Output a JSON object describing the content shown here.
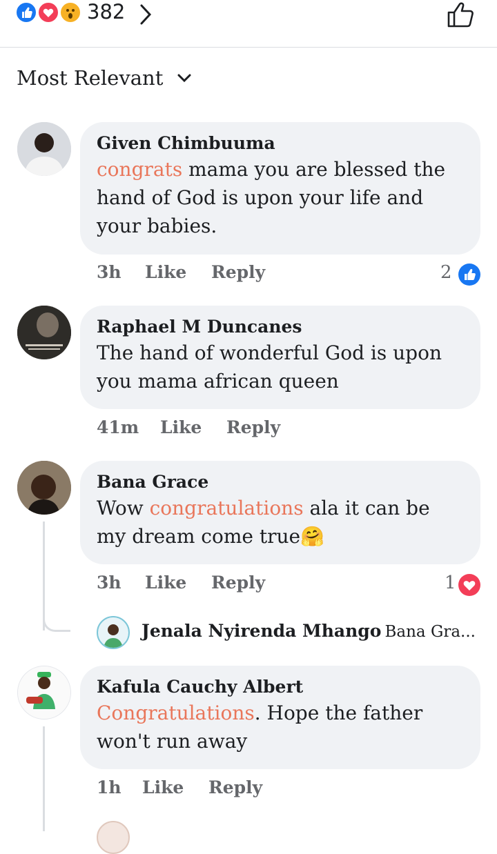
{
  "reactions": {
    "count": "382",
    "types": [
      "like-icon",
      "love-icon",
      "wow-icon"
    ],
    "colors": {
      "like": "#1877f2",
      "love": "#f33e58",
      "wow": "#f7b125"
    }
  },
  "sort": {
    "label": "Most Relevant"
  },
  "comments": [
    {
      "name": "Given Chimbuuma",
      "highlight": "congrats",
      "text": " mama you are blessed the hand of God is upon your life and your babies.",
      "time": "3h",
      "like": "Like",
      "reply": "Reply",
      "reaction_count": "2",
      "reaction": "like"
    },
    {
      "name": "Raphael M Duncanes",
      "highlight": "",
      "text": "The hand of wonderful God is upon you mama african queen",
      "time": "41m",
      "like": "Like",
      "reply": "Reply"
    },
    {
      "name": "Bana Grace",
      "pre": "Wow ",
      "highlight": "congratulations",
      "text": " ala it can be my dream come true🤗",
      "time": "3h",
      "like": "Like",
      "reply": "Reply",
      "reaction_count": "1",
      "reaction": "love",
      "reply_preview": {
        "name": "Jenala Nyirenda Mhango",
        "snippet": "Bana Gra..."
      }
    },
    {
      "name": "Kafula Cauchy Albert",
      "highlight": "Congratulations",
      "text": ". Hope the father won't run away",
      "time": "1h",
      "like": "Like",
      "reply": "Reply"
    }
  ]
}
